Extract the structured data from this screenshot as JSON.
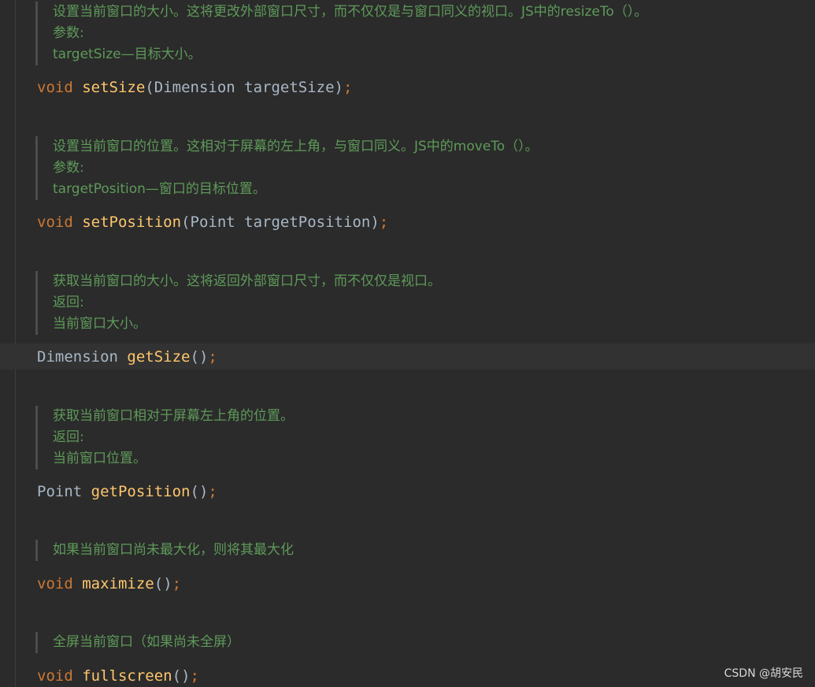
{
  "docs": [
    {
      "lines": [
        "设置当前窗口的大小。这将更改外部窗口尺寸，而不仅仅是与窗口同义的视口。JS中的resizeTo（）。",
        "参数:",
        "targetSize—目标大小。"
      ]
    },
    {
      "lines": [
        "设置当前窗口的位置。这相对于屏幕的左上角，与窗口同义。JS中的moveTo（）。",
        "参数:",
        "targetPosition—窗口的目标位置。"
      ]
    },
    {
      "lines": [
        "获取当前窗口的大小。这将返回外部窗口尺寸，而不仅仅是视口。",
        "返回:",
        "当前窗口大小。"
      ]
    },
    {
      "lines": [
        "获取当前窗口相对于屏幕左上角的位置。",
        "返回:",
        "当前窗口位置。"
      ]
    },
    {
      "lines": [
        "如果当前窗口尚未最大化，则将其最大化"
      ]
    },
    {
      "lines": [
        "全屏当前窗口（如果尚未全屏）"
      ]
    }
  ],
  "code": [
    {
      "ret": "void",
      "name": "setSize",
      "open": "(",
      "ptype": "Dimension",
      "pname": "targetSize",
      "close": ")",
      "semi": ";"
    },
    {
      "ret": "void",
      "name": "setPosition",
      "open": "(",
      "ptype": "Point",
      "pname": "targetPosition",
      "close": ")",
      "semi": ";"
    },
    {
      "ret": "Dimension",
      "name": "getSize",
      "open": "(",
      "ptype": "",
      "pname": "",
      "close": ")",
      "semi": ";"
    },
    {
      "ret": "Point",
      "name": "getPosition",
      "open": "(",
      "ptype": "",
      "pname": "",
      "close": ")",
      "semi": ";"
    },
    {
      "ret": "void",
      "name": "maximize",
      "open": "(",
      "ptype": "",
      "pname": "",
      "close": ")",
      "semi": ";"
    },
    {
      "ret": "void",
      "name": "fullscreen",
      "open": "(",
      "ptype": "",
      "pname": "",
      "close": ")",
      "semi": ";"
    }
  ],
  "watermark": "CSDN @胡安民",
  "colors": {
    "background": "#2b2b2b",
    "doc_comment": "#5e9a59",
    "keyword": "#cc7832",
    "function": "#ffc66d",
    "identifier": "#a9b7c6"
  }
}
